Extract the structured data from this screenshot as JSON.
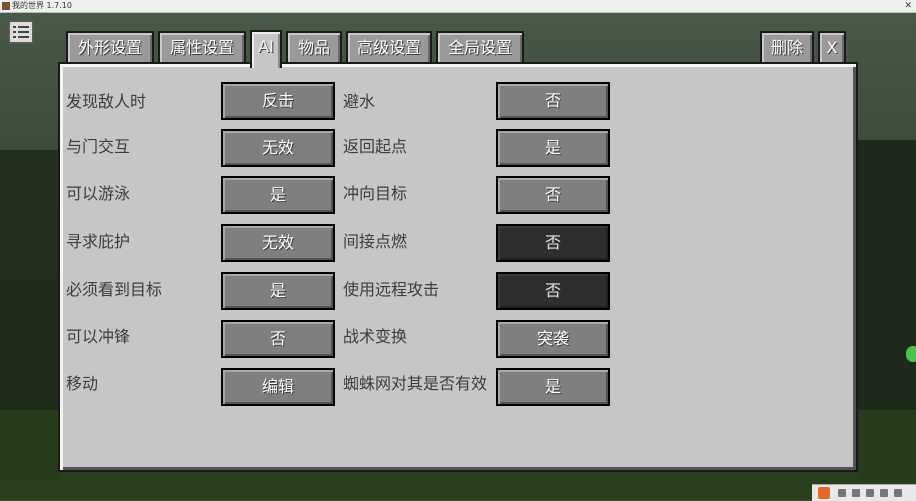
{
  "window": {
    "title": "我的世界 1.7.10"
  },
  "tabs": [
    {
      "label": "外形设置"
    },
    {
      "label": "属性设置"
    },
    {
      "label": "AI"
    },
    {
      "label": "物品"
    },
    {
      "label": "高级设置"
    },
    {
      "label": "全局设置"
    }
  ],
  "actions": {
    "delete_label": "删除",
    "close_label": "X"
  },
  "left_rows": [
    {
      "label": "发现敌人时",
      "value": "反击"
    },
    {
      "label": "与门交互",
      "value": "无效"
    },
    {
      "label": "可以游泳",
      "value": "是"
    },
    {
      "label": "寻求庇护",
      "value": "无效"
    },
    {
      "label": "必须看到目标",
      "value": "是"
    },
    {
      "label": "可以冲锋",
      "value": "否"
    },
    {
      "label": "移动",
      "value": "编辑"
    }
  ],
  "right_rows": [
    {
      "label": "避水",
      "value": "否",
      "enabled": true
    },
    {
      "label": "返回起点",
      "value": "是",
      "enabled": true
    },
    {
      "label": "冲向目标",
      "value": "否",
      "enabled": true
    },
    {
      "label": "间接点燃",
      "value": "否",
      "enabled": false
    },
    {
      "label": "使用远程攻击",
      "value": "否",
      "enabled": false
    },
    {
      "label": "战术变换",
      "value": "突袭",
      "enabled": true
    },
    {
      "label": "蜘蛛网对其是否有效",
      "value": "是",
      "enabled": true
    }
  ],
  "colors": {
    "panel": "#c6c6c6",
    "button": "#7f7f7f",
    "button_disabled": "#2e2e2e",
    "tab": "#9a9a9a"
  }
}
